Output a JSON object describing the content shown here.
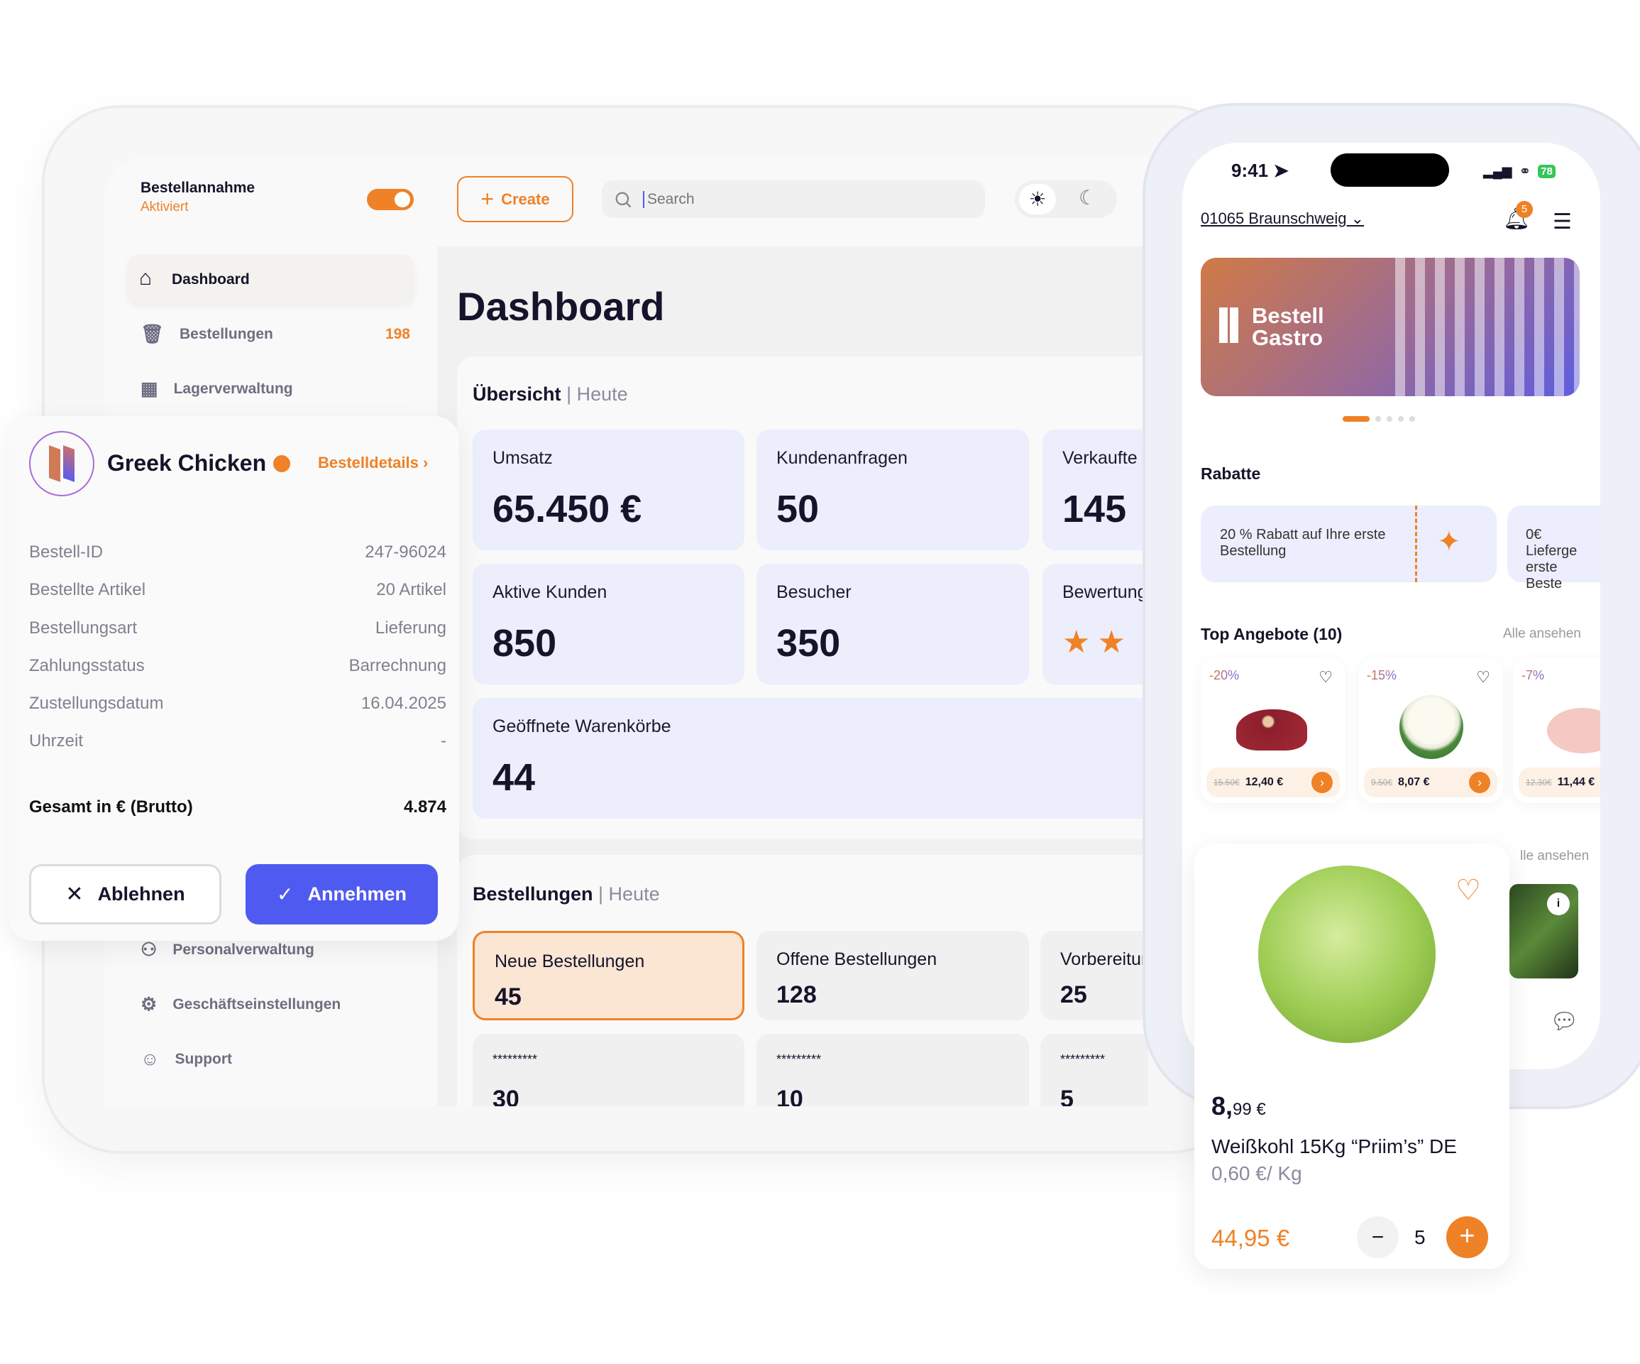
{
  "colors": {
    "accent": "#ef8127",
    "primary": "#4f5bf0",
    "card": "#eceefb"
  },
  "sidebar": {
    "toggle_title": "Bestellannahme",
    "toggle_status": "Aktiviert",
    "toggle_on": true,
    "items": [
      {
        "label": "Dashboard",
        "icon": "home-icon",
        "active": true
      },
      {
        "label": "Bestellungen",
        "icon": "basket-icon",
        "badge": "198"
      },
      {
        "label": "Lagerverwaltung",
        "icon": "warehouse-icon"
      },
      {
        "label": "Personalverwaltung",
        "icon": "users-icon"
      },
      {
        "label": "Geschäftseinstellungen",
        "icon": "gear-icon"
      },
      {
        "label": "Support",
        "icon": "smiley-icon"
      }
    ]
  },
  "toolbar": {
    "create_label": "Create",
    "search_placeholder": "Search",
    "theme": "light"
  },
  "main": {
    "title": "Dashboard",
    "overview": {
      "title": "Übersicht",
      "period": "| Heute",
      "cards": [
        {
          "label": "Umsatz",
          "value": "65.450 €"
        },
        {
          "label": "Kundenanfragen",
          "value": "50"
        },
        {
          "label": "Verkaufte",
          "value": "145"
        },
        {
          "label": "Aktive Kunden",
          "value": "850"
        },
        {
          "label": "Besucher",
          "value": "350"
        },
        {
          "label": "Bewertung",
          "rating": 2
        },
        {
          "label": "Geöffnete Warenkörbe",
          "value": "44"
        }
      ]
    },
    "orders": {
      "title": "Bestellungen",
      "period": "| Heute",
      "cards": [
        {
          "label": "Neue Bestellungen",
          "value": "45"
        },
        {
          "label": "Offene Bestellungen",
          "value": "128"
        },
        {
          "label": "Vorbereitur",
          "value": "25"
        },
        {
          "label": "*********",
          "value": "30"
        },
        {
          "label": "*********",
          "value": "10"
        },
        {
          "label": "*********",
          "value": "5"
        }
      ]
    }
  },
  "popup": {
    "name": "Greek Chicken",
    "details_link": "Bestelldetails",
    "rows": [
      {
        "label": "Bestell-ID",
        "value": "247-96024"
      },
      {
        "label": "Bestellte Artikel",
        "value": "20 Artikel"
      },
      {
        "label": "Bestellungsart",
        "value": "Lieferung"
      },
      {
        "label": "Zahlungsstatus",
        "value": "Barrechnung"
      },
      {
        "label": "Zustellungsdatum",
        "value": "16.04.2025"
      },
      {
        "label": "Uhrzeit",
        "value": "-"
      }
    ],
    "total_label": "Gesamt in € (Brutto)",
    "total_value": "4.874",
    "reject": "Ablehnen",
    "accept": "Annehmen"
  },
  "phone": {
    "time": "9:41",
    "battery": "78",
    "location": "01065 Braunschweig",
    "notifications": "5",
    "banner": {
      "line1": "Bestell",
      "line2": "Gastro",
      "slides": 5,
      "active_slide": 1
    },
    "discounts_title": "Rabatte",
    "discounts": [
      "20 % Rabatt auf Ihre erste Bestellung",
      "0€ Lieferge erste Beste"
    ],
    "offers_title": "Top Angebote (10)",
    "see_all": "Alle ansehen",
    "see_all_2": "lle ansehen",
    "offers": [
      {
        "discount": "-20%",
        "old": "15.50€",
        "price": "12,40 €"
      },
      {
        "discount": "-15%",
        "old": "9.50€",
        "price": "8,07 €"
      },
      {
        "discount": "-7%",
        "old": "12.30€",
        "price": "11,44 €"
      }
    ],
    "product": {
      "price_main": "8,",
      "price_cents": "99 €",
      "name": "Weißkohl 15Kg “Priim’s” DE",
      "unit_price": "0,60 €/ Kg",
      "total": "44,95 €",
      "quantity": "5"
    }
  }
}
